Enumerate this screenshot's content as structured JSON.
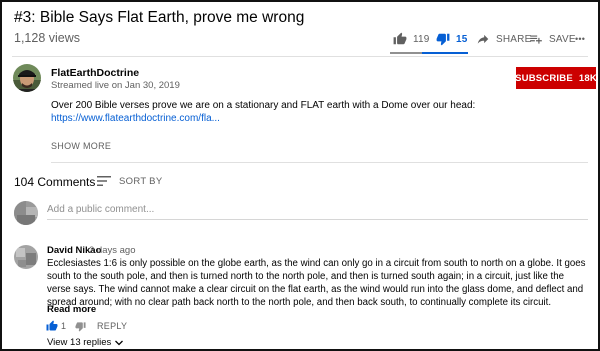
{
  "video": {
    "title": "#3: Bible Says Flat Earth, prove me wrong",
    "views": "1,128 views"
  },
  "actions": {
    "like_count": "119",
    "dislike_count": "15",
    "share_label": "SHARE",
    "save_label": "SAVE",
    "more_label": "•••"
  },
  "channel": {
    "name": "FlatEarthDoctrine",
    "stream_date": "Streamed live on Jan 30, 2019",
    "subscribe_label": "SUBSCRIBE",
    "subscriber_count": "18K"
  },
  "description": {
    "text": "Over 200 Bible verses prove we are on a stationary and FLAT earth with a Dome over our head:",
    "link": "https://www.flatearthdoctrine.com/fla...",
    "show_more": "SHOW MORE"
  },
  "comments": {
    "count": "104 Comments",
    "sort_label": "SORT BY",
    "add_placeholder": "Add a public comment...",
    "items": [
      {
        "author": "David Nikao",
        "time": "2 days ago",
        "text": "Ecclesiastes 1:6 is only possible on the globe earth, as the wind can only go in a circuit from south to north on a globe.  It goes south to the south pole, and then is turned north to the north pole, and then is turned south again; in a circuit, just like the verse says.  The wind cannot make a clear circuit on the flat earth, as the wind would run into the glass dome, and deflect and spread around; with no clear path back north to the north pole, and then back south, to continually complete its circuit.",
        "read_more": "Read more",
        "likes": "1",
        "reply_label": "REPLY",
        "view_replies": "View 13 replies"
      }
    ]
  },
  "colors": {
    "accent_blue": "#065fd4",
    "subscribe_red": "#cc0000",
    "muted": "#606060"
  }
}
